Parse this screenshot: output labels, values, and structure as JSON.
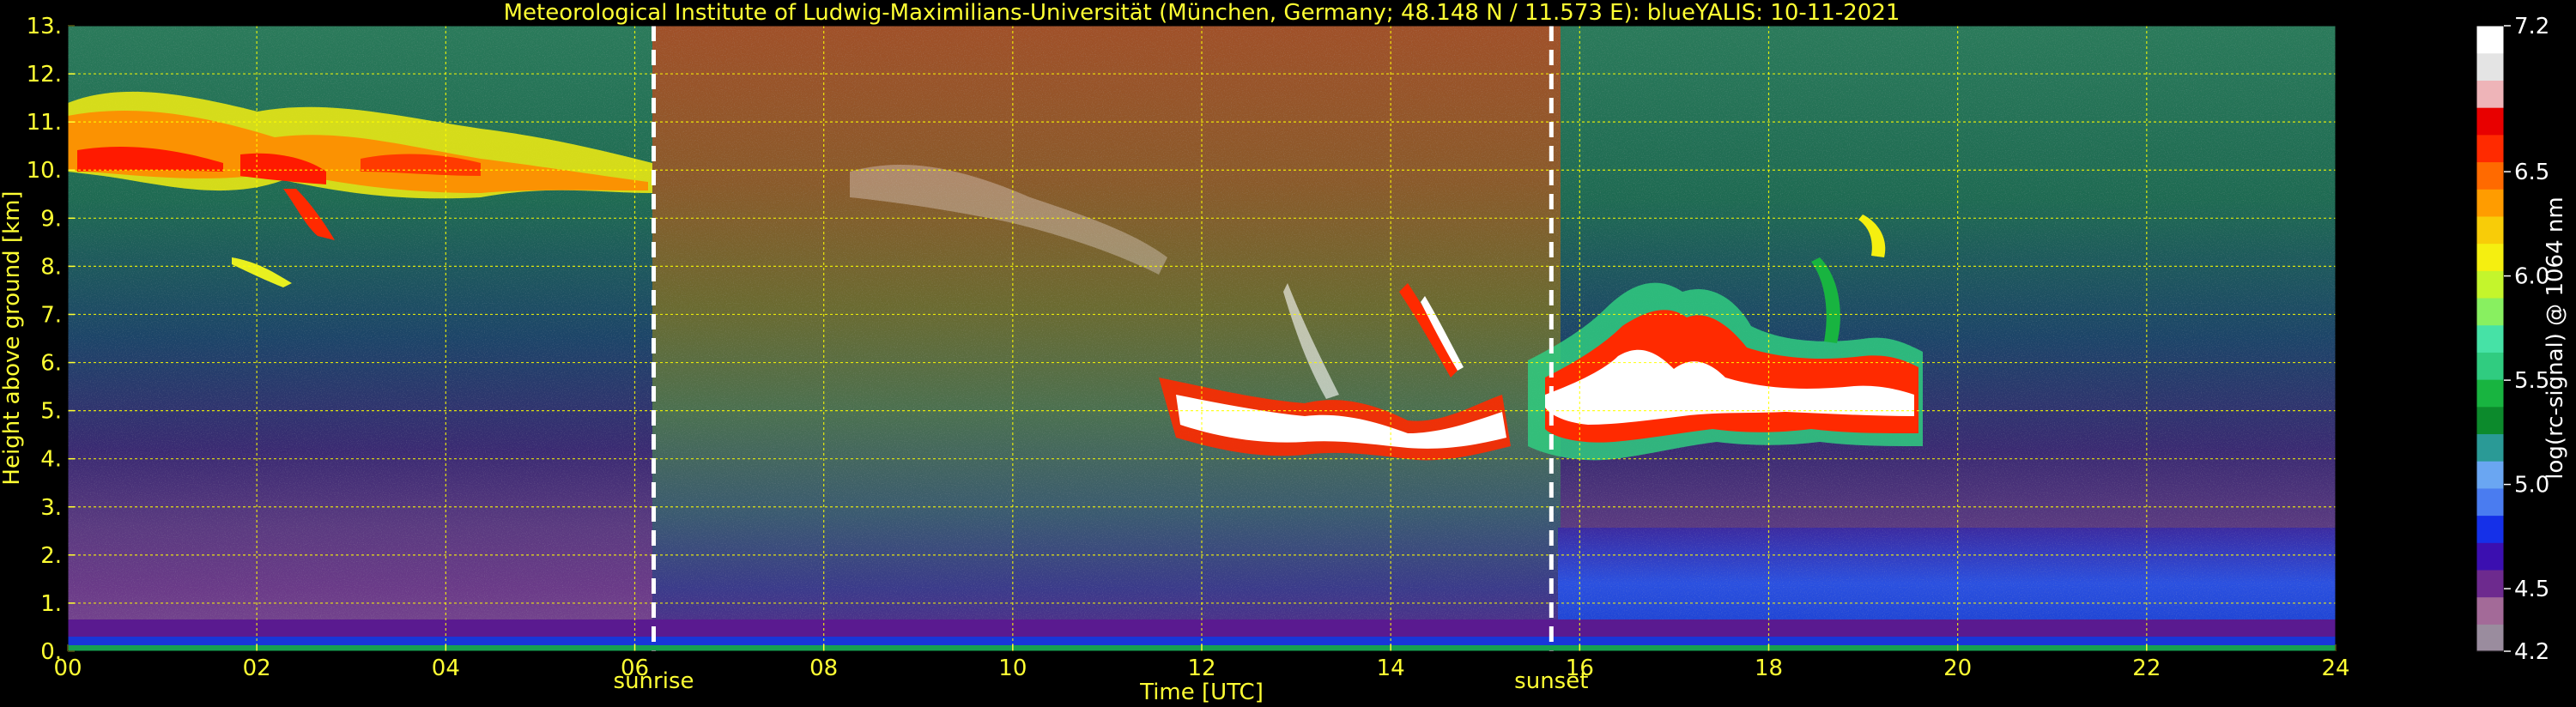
{
  "chart_data": {
    "type": "heatmap",
    "title": "Meteorological Institute of Ludwig-Maximilians-Universität (München, Germany; 48.148 N / 11.573 E):    blueYALIS: 10-11-2021",
    "xlabel": "Time [UTC]",
    "ylabel": "Height above ground [km]",
    "xlim": [
      0,
      24
    ],
    "ylim": [
      0,
      13
    ],
    "x_ticks": [
      "00",
      "02",
      "04",
      "06",
      "08",
      "10",
      "12",
      "14",
      "16",
      "18",
      "20",
      "22",
      "24"
    ],
    "y_ticks": [
      "0.",
      "1.",
      "2.",
      "3.",
      "4.",
      "5.",
      "6.",
      "7.",
      "8.",
      "9.",
      "10.",
      "11.",
      "12.",
      "13."
    ],
    "grid": true,
    "vertical_lines": [
      {
        "label": "sunrise",
        "x": 6.2
      },
      {
        "label": "sunset",
        "x": 15.7
      }
    ],
    "colorbar": {
      "label": "log(rc-signal) @ 1064 nm",
      "range": [
        4.2,
        7.2
      ],
      "ticks": [
        "4.2",
        "4.5",
        "5.0",
        "5.5",
        "6.0",
        "6.5",
        "7.2"
      ],
      "colors": [
        "#9a8c9e",
        "#a36a98",
        "#6d2a8e",
        "#3b0fb0",
        "#1530e8",
        "#4a7cf0",
        "#6aa6f2",
        "#2a9a96",
        "#0c8a2c",
        "#18b440",
        "#30cc80",
        "#46e2a6",
        "#88f060",
        "#c4f52c",
        "#f5ef10",
        "#f8cc08",
        "#ff9c00",
        "#ff6a00",
        "#ff2a00",
        "#e80000",
        "#eeb4b8",
        "#e4e4e4",
        "#ffffff"
      ]
    }
  }
}
